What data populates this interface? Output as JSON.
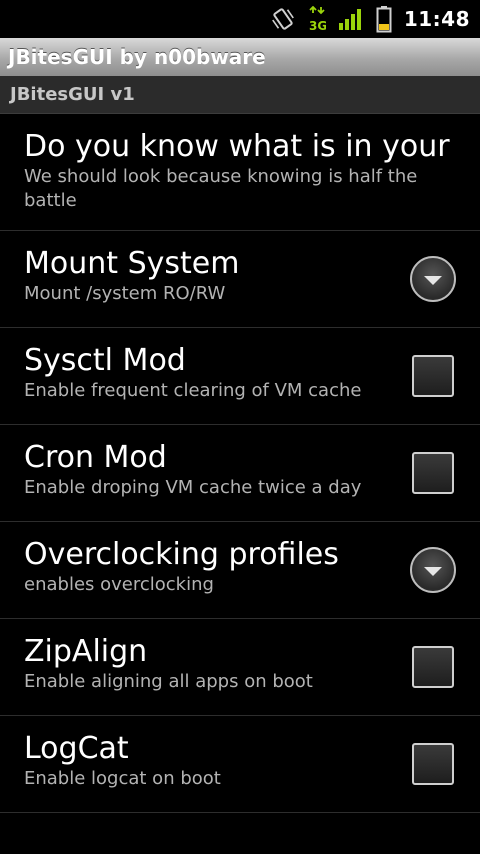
{
  "status_bar": {
    "time": "11:48",
    "icons": [
      "vibrate-icon",
      "3g-icon",
      "signal-icon",
      "battery-icon"
    ],
    "accent_color": "#9bd40b"
  },
  "title_bar": {
    "title": "JBitesGUI by n00bware"
  },
  "category": {
    "title": "JBitesGUI v1"
  },
  "preferences": [
    {
      "title": "Do you know what is in your",
      "summary": "We should look because knowing is half the battle",
      "widget": "none"
    },
    {
      "title": "Mount System",
      "summary": "Mount /system RO/RW",
      "widget": "dropdown"
    },
    {
      "title": "Sysctl Mod",
      "summary": "Enable frequent clearing of VM cache",
      "widget": "checkbox",
      "checked": false
    },
    {
      "title": "Cron Mod",
      "summary": "Enable droping VM cache twice a day",
      "widget": "checkbox",
      "checked": false
    },
    {
      "title": "Overclocking profiles",
      "summary": "enables overclocking",
      "widget": "dropdown"
    },
    {
      "title": "ZipAlign",
      "summary": "Enable aligning all apps on boot",
      "widget": "checkbox",
      "checked": false
    },
    {
      "title": "LogCat",
      "summary": "Enable logcat on boot",
      "widget": "checkbox",
      "checked": false
    }
  ]
}
